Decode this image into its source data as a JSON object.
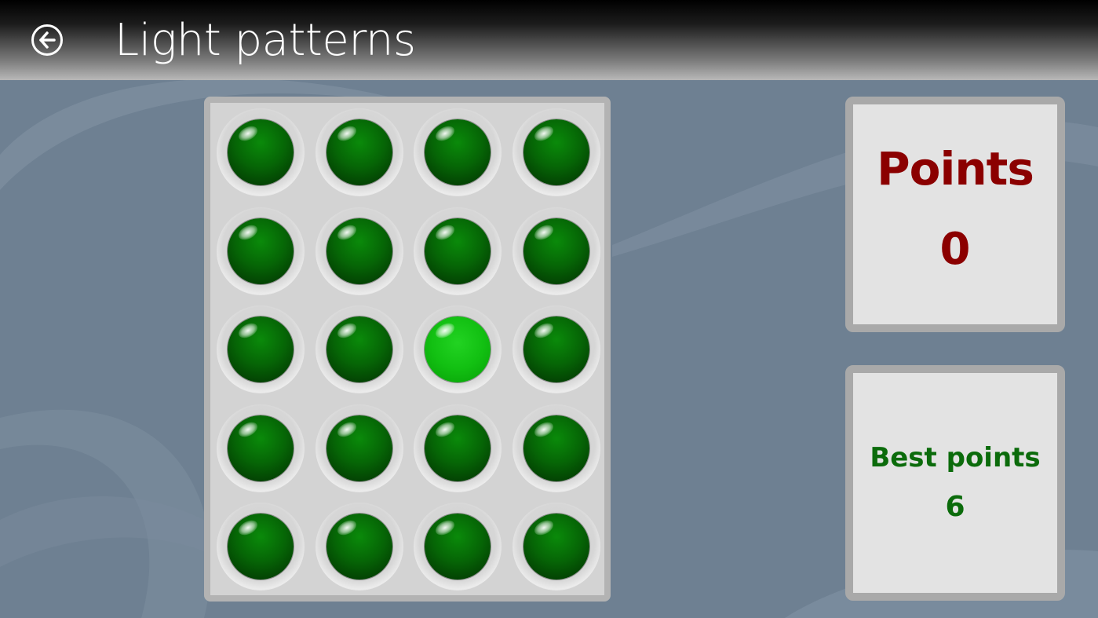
{
  "header": {
    "title": "Light patterns",
    "back_icon": "back-arrow-icon"
  },
  "board": {
    "rows": 5,
    "columns": 4,
    "lit_light": {
      "row": 3,
      "column": 3
    },
    "colors": {
      "light_off": "#066606",
      "light_on": "#12c012",
      "board_fill": "#d3d3d3",
      "board_border": "#b3b3b3"
    }
  },
  "score": {
    "points_label": "Points",
    "points_value": "0",
    "best_label": "Best points",
    "best_value": "6",
    "colors": {
      "points_text": "#8b0000",
      "best_text": "#0b6b0b",
      "panel_fill": "#e3e3e3",
      "panel_border": "#a9a9a9"
    }
  },
  "colors": {
    "background": "#6e8092",
    "header_text": "#ffffff"
  }
}
